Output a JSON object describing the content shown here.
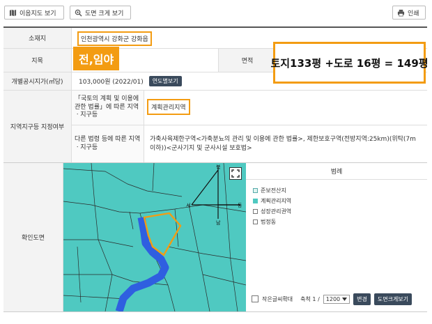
{
  "toolbar": {
    "map_button": "이음지도 보기",
    "zoom_button": "도면 크게 보기",
    "print_button": "인쇄"
  },
  "table": {
    "location_label": "소재지",
    "location_value": "인천광역시 강화군 강화읍",
    "jimok_label": "지목",
    "jimok_value": "전,임야",
    "area_label": "면적",
    "area_annotation": "토지133평 +도로 16평 = 149평",
    "price_label": "개별공시지가(㎡당)",
    "price_value": "103,000원 (2022/01)",
    "price_button": "연도별보기",
    "zone_label": "지역지구등 지정여부",
    "law1_label": "「국토의 계획 및 이용에 관한 법률」에 따른 지역ㆍ지구등",
    "law1_value": "계획관리지역",
    "law2_label": "다른 법령 등에 따른 지역ㆍ지구등",
    "law2_value": "가축사육제한구역<가축분뇨의 관리 및 이용에 관한 법률>, 제한보호구역(전방지역:25km)(위탁(7m이하))<군사기지 및 군사시설 보호법>",
    "map_label": "확인도면"
  },
  "map": {
    "compass_n": "북",
    "compass_s": "남",
    "compass_e": "동",
    "compass_w": "서"
  },
  "legend": {
    "title": "범례",
    "items": [
      "준보전산지",
      "계획관리지역",
      "성장관리권역",
      "법정동"
    ]
  },
  "controls": {
    "small_text_label": "작은글씨확대",
    "scale_label": "축척 1 /",
    "scale_value": "1200",
    "change_button": "변경",
    "enlarge_button": "도면크게보기"
  },
  "colors": {
    "accent_orange": "#f39c12",
    "map_teal": "#4fc9c1",
    "river_blue": "#2f5fe0"
  }
}
